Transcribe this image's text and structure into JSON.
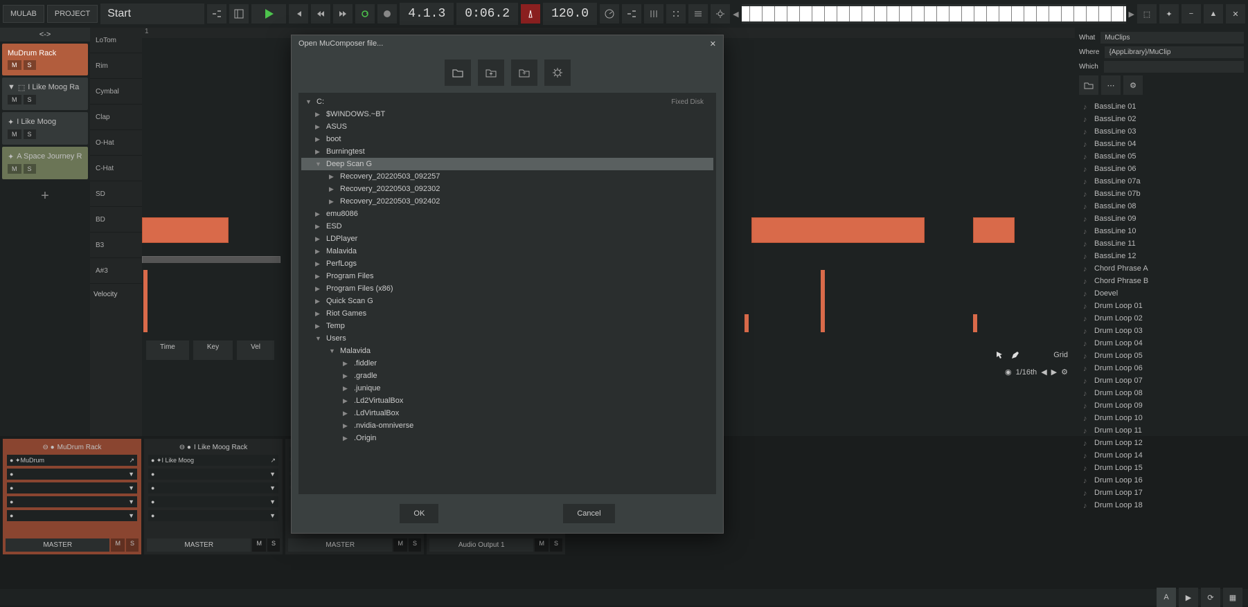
{
  "toolbar": {
    "mulab_btn": "MULAB",
    "project_btn": "PROJECT",
    "start_text": "Start",
    "position": "4.1.3",
    "time": "0:06.2",
    "tempo": "120.0"
  },
  "nav": {
    "prev_next": "<->"
  },
  "tracks": [
    {
      "name": "MuDrum Rack",
      "type": "orange"
    },
    {
      "name": "I Like Moog Ra",
      "type": "dark"
    },
    {
      "name": "I Like Moog",
      "type": "dark"
    },
    {
      "name": "A Space Journey R",
      "type": "olive"
    }
  ],
  "ms": {
    "m": "M",
    "s": "S"
  },
  "lanes": [
    "LoTom",
    "Rim",
    "Cymbal",
    "Clap",
    "O-Hat",
    "C-Hat",
    "SD",
    "BD",
    "B3",
    "A#3"
  ],
  "ruler": {
    "bar": "1"
  },
  "velocity_label": "Velocity",
  "bottom_ctrls": {
    "time": "Time",
    "key": "Key",
    "vel": "Vel"
  },
  "grid": {
    "label": "Grid",
    "value": "1/16th"
  },
  "search": {
    "what_label": "What",
    "what_val": "MuClips",
    "where_label": "Where",
    "where_val": "{AppLibrary}/MuClip",
    "which_label": "Which"
  },
  "library": [
    "BassLine 01",
    "BassLine 02",
    "BassLine 03",
    "BassLine 04",
    "BassLine 05",
    "BassLine 06",
    "BassLine 07a",
    "BassLine 07b",
    "BassLine 08",
    "BassLine 09",
    "BassLine 10",
    "BassLine 11",
    "BassLine 12",
    "Chord Phrase A",
    "Chord Phrase B",
    "Doevel",
    "Drum Loop 01",
    "Drum Loop 02",
    "Drum Loop 03",
    "Drum Loop 04",
    "Drum Loop 05",
    "Drum Loop 06",
    "Drum Loop 07",
    "Drum Loop 08",
    "Drum Loop 09",
    "Drum Loop 10",
    "Drum Loop 11",
    "Drum Loop 12",
    "Drum Loop 14",
    "Drum Loop 15",
    "Drum Loop 16",
    "Drum Loop 17",
    "Drum Loop 18"
  ],
  "mixer": {
    "strips": [
      {
        "title": "MuDrum Rack",
        "inst": "MuDrum",
        "master": "MASTER"
      },
      {
        "title": "I Like Moog Rack",
        "inst": "I Like Moog",
        "master": "MASTER"
      },
      {
        "title": "",
        "inst": "",
        "master": "MASTER"
      },
      {
        "title": "",
        "inst": "",
        "master": "Audio Output 1"
      }
    ]
  },
  "modal": {
    "title": "Open MuComposer file...",
    "disk": "Fixed Disk",
    "tree": [
      {
        "label": "C:",
        "level": 0,
        "exp": "▼",
        "disk": true
      },
      {
        "label": "$WINDOWS.~BT",
        "level": 1,
        "exp": "▶"
      },
      {
        "label": "ASUS",
        "level": 1,
        "exp": "▶"
      },
      {
        "label": "boot",
        "level": 1,
        "exp": "▶"
      },
      {
        "label": "Burningtest",
        "level": 1,
        "exp": "▶"
      },
      {
        "label": "Deep Scan G",
        "level": 1,
        "exp": "▼",
        "selected": true
      },
      {
        "label": "Recovery_20220503_092257",
        "level": 2,
        "exp": "▶"
      },
      {
        "label": "Recovery_20220503_092302",
        "level": 2,
        "exp": "▶"
      },
      {
        "label": "Recovery_20220503_092402",
        "level": 2,
        "exp": "▶"
      },
      {
        "label": "emu8086",
        "level": 1,
        "exp": "▶"
      },
      {
        "label": "ESD",
        "level": 1,
        "exp": "▶"
      },
      {
        "label": "LDPlayer",
        "level": 1,
        "exp": "▶"
      },
      {
        "label": "Malavida",
        "level": 1,
        "exp": "▶"
      },
      {
        "label": "PerfLogs",
        "level": 1,
        "exp": "▶"
      },
      {
        "label": "Program Files",
        "level": 1,
        "exp": "▶"
      },
      {
        "label": "Program Files (x86)",
        "level": 1,
        "exp": "▶"
      },
      {
        "label": "Quick Scan G",
        "level": 1,
        "exp": "▶"
      },
      {
        "label": "Riot Games",
        "level": 1,
        "exp": "▶"
      },
      {
        "label": "Temp",
        "level": 1,
        "exp": "▶"
      },
      {
        "label": "Users",
        "level": 1,
        "exp": "▼"
      },
      {
        "label": "Malavida",
        "level": 2,
        "exp": "▼"
      },
      {
        "label": ".fiddler",
        "level": 3,
        "exp": "▶"
      },
      {
        "label": ".gradle",
        "level": 3,
        "exp": "▶"
      },
      {
        "label": ".junique",
        "level": 3,
        "exp": "▶"
      },
      {
        "label": ".Ld2VirtualBox",
        "level": 3,
        "exp": "▶"
      },
      {
        "label": ".LdVirtualBox",
        "level": 3,
        "exp": "▶"
      },
      {
        "label": ".nvidia-omniverse",
        "level": 3,
        "exp": "▶"
      },
      {
        "label": ".Origin",
        "level": 3,
        "exp": "▶"
      }
    ],
    "ok": "OK",
    "cancel": "Cancel"
  },
  "footer": {
    "a_btn": "A"
  }
}
